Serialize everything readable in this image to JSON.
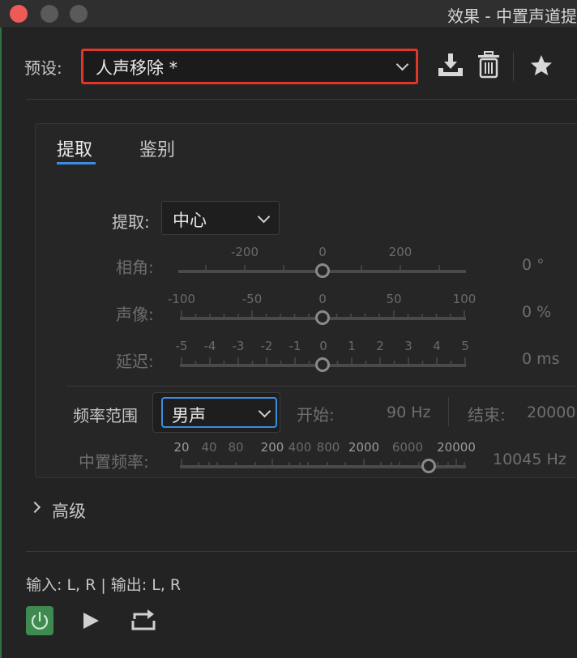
{
  "window": {
    "title": "效果 - 中置声道提"
  },
  "preset": {
    "label": "预设:",
    "value": "人声移除 *"
  },
  "tabs": [
    {
      "label": "提取",
      "active": true
    },
    {
      "label": "鉴别",
      "active": false
    }
  ],
  "extract": {
    "label": "提取:",
    "value": "中心"
  },
  "sliders": {
    "phase": {
      "label": "相角:",
      "ticks": [
        "-200",
        "0",
        "200"
      ],
      "value_text": "0 °",
      "value": 0,
      "min": -300,
      "max": 300
    },
    "pan": {
      "label": "声像:",
      "ticks": [
        "-100",
        "-50",
        "0",
        "50",
        "100"
      ],
      "value_text": "0 %",
      "value": 0,
      "min": -100,
      "max": 100
    },
    "delay": {
      "label": "延迟:",
      "ticks": [
        "-5",
        "-4",
        "-3",
        "-2",
        "-1",
        "0",
        "1",
        "2",
        "3",
        "4",
        "5"
      ],
      "value_text": "0 ms",
      "value": 0,
      "min": -5,
      "max": 5
    },
    "center_freq": {
      "label": "中置频率:",
      "ticks": [
        "20",
        "40",
        "80",
        "200",
        "400",
        "800",
        "2000",
        "6000",
        "20000"
      ],
      "value_text": "10045 Hz",
      "value": 10045
    }
  },
  "freq_range": {
    "label": "频率范围",
    "value": "男声",
    "start_label": "开始:",
    "start_value": "90 Hz",
    "end_label": "结束:",
    "end_value": "20000"
  },
  "advanced": {
    "label": "高级"
  },
  "io": {
    "text": "输入: L, R | 输出: L, R"
  },
  "icons": [
    "download-icon",
    "trash-icon",
    "star-icon",
    "power-icon",
    "play-icon",
    "loop-icon"
  ],
  "colors": {
    "highlight": "#e0362b",
    "accent": "#3c8ce0",
    "power": "#3f8a50"
  }
}
